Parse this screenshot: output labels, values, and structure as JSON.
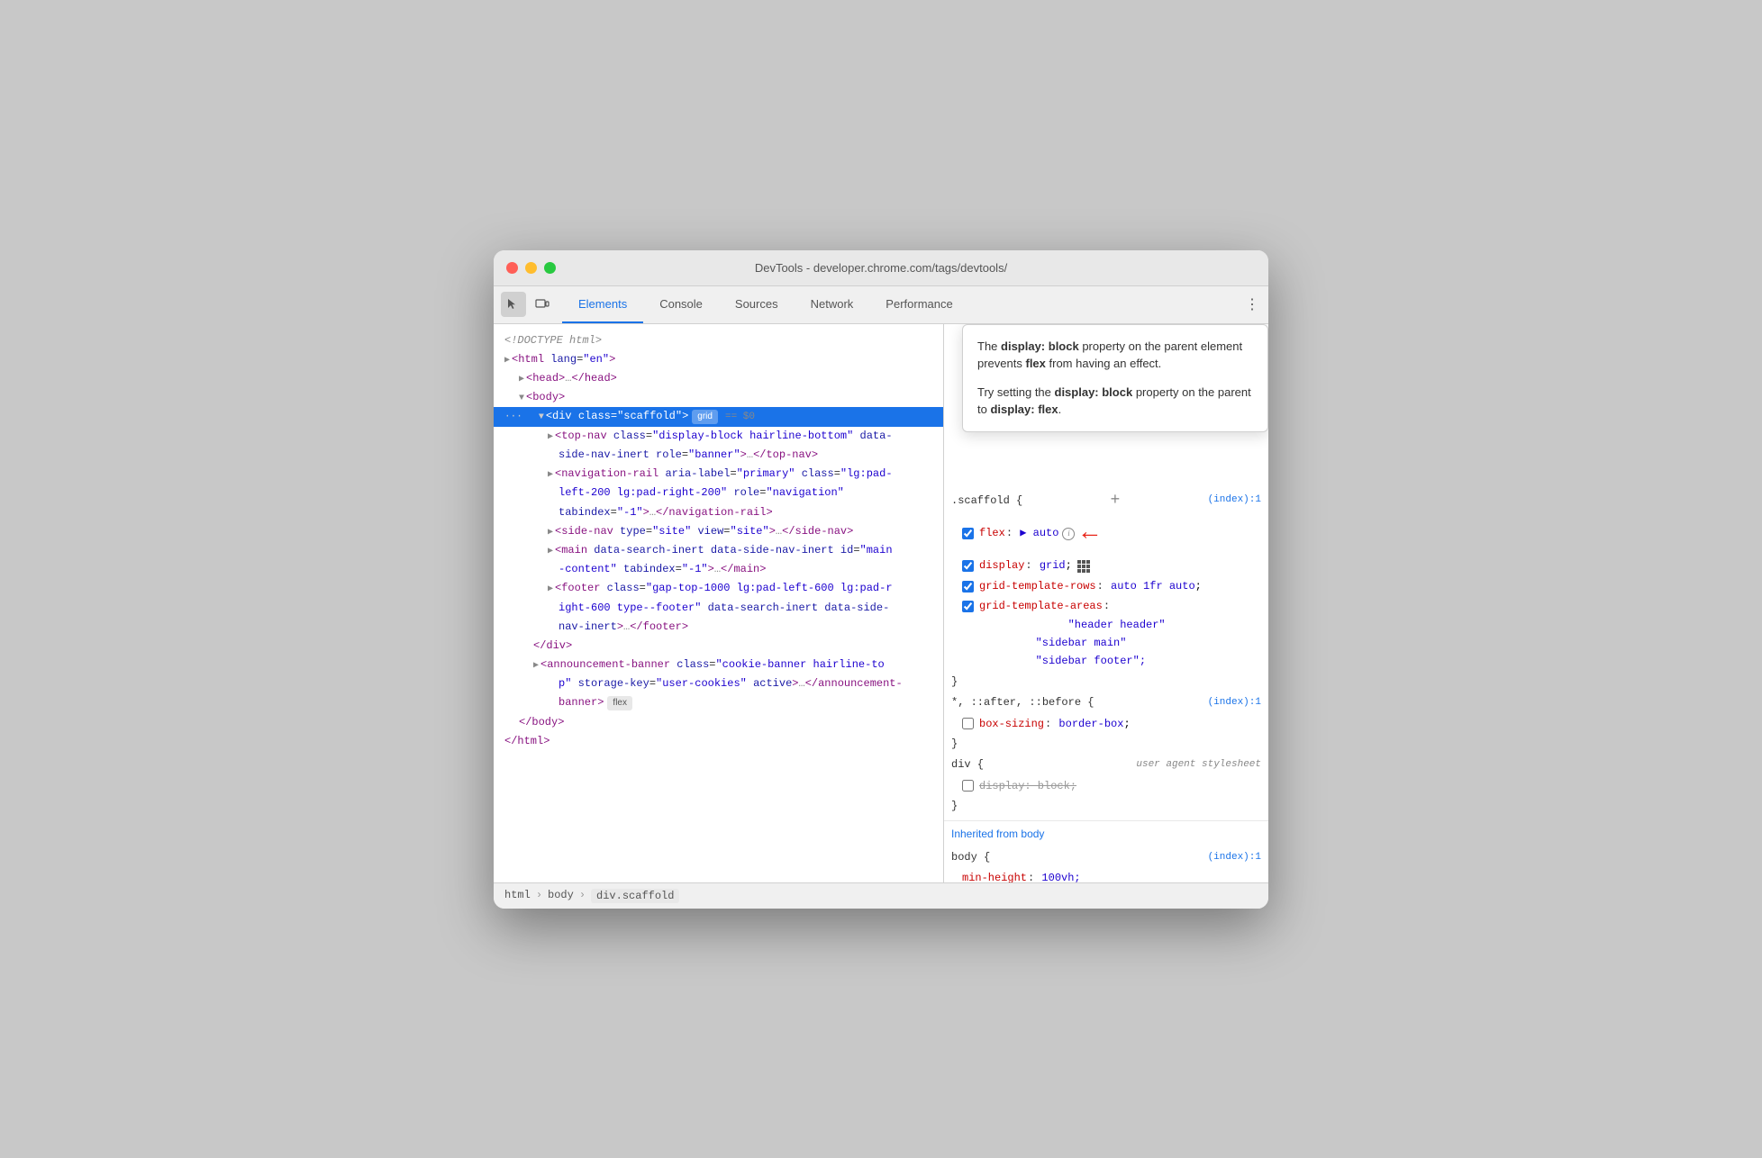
{
  "window": {
    "title": "DevTools - developer.chrome.com/tags/devtools/",
    "buttons": {
      "close": "close",
      "minimize": "minimize",
      "maximize": "maximize"
    }
  },
  "tabbar": {
    "icons": [
      "cursor-icon",
      "device-icon"
    ],
    "tabs": [
      {
        "label": "Elements",
        "active": true
      },
      {
        "label": "Console",
        "active": false
      },
      {
        "label": "Sources",
        "active": false
      },
      {
        "label": "Network",
        "active": false
      },
      {
        "label": "Performance",
        "active": false
      }
    ],
    "more_label": "⋮"
  },
  "tooltip": {
    "line1_text": "The ",
    "line1_bold1": "display: block",
    "line1_text2": " property on the parent element prevents ",
    "line1_bold2": "flex",
    "line1_text3": " from having an effect.",
    "line2_text": "Try setting the ",
    "line2_bold1": "display: block",
    "line2_text2": " property on the parent to ",
    "line2_bold2": "display: flex",
    "line2_text3": "."
  },
  "html_tree": {
    "lines": [
      {
        "indent": 0,
        "text": "<!DOCTYPE html>",
        "type": "comment"
      },
      {
        "indent": 0,
        "text": "<html lang=\"en\">",
        "type": "tag"
      },
      {
        "indent": 1,
        "text": "<head>…</head>",
        "type": "tag",
        "arrow": true
      },
      {
        "indent": 1,
        "text": "<body>",
        "type": "tag",
        "arrow": true,
        "open": true
      },
      {
        "indent": 2,
        "text": "<div class=\"scaffold\">",
        "type": "selected",
        "badge": "grid",
        "eq": "== $0"
      },
      {
        "indent": 3,
        "text": "<top-nav class=\"display-block hairline-bottom\" data-side-nav-inert role=\"banner\">…</top-nav>",
        "type": "tag",
        "arrow": true
      },
      {
        "indent": 3,
        "text": "<navigation-rail aria-label=\"primary\" class=\"lg:pad-left-200 lg:pad-right-200\" role=\"navigation\" tabindex=\"-1\">…</navigation-rail>",
        "type": "tag",
        "arrow": true
      },
      {
        "indent": 3,
        "text": "<side-nav type=\"site\" view=\"site\">…</side-nav>",
        "type": "tag",
        "arrow": true
      },
      {
        "indent": 3,
        "text": "<main data-search-inert data-side-nav-inert id=\"main-content\" tabindex=\"-1\">…</main>",
        "type": "tag",
        "arrow": true
      },
      {
        "indent": 3,
        "text": "<footer class=\"gap-top-1000 lg:pad-left-600 lg:pad-right-600 type--footer\" data-search-inert data-side-nav-inert>…</footer>",
        "type": "tag",
        "arrow": true
      },
      {
        "indent": 2,
        "text": "</div>",
        "type": "tag"
      },
      {
        "indent": 2,
        "text": "<announcement-banner class=\"cookie-banner hairline-top\" storage-key=\"user-cookies\" active>…</announcement-banner>",
        "type": "tag",
        "arrow": true,
        "badge": "flex"
      },
      {
        "indent": 1,
        "text": "</body>",
        "type": "tag"
      },
      {
        "indent": 0,
        "text": "</html>",
        "type": "tag"
      }
    ]
  },
  "css_rules": {
    "sections": [
      {
        "selector": ".scaffold {",
        "origin": "(index):1",
        "properties": [
          {
            "checked": true,
            "name": "flex",
            "value": "auto",
            "has_arrow": true,
            "has_info": true
          },
          {
            "checked": true,
            "name": "display",
            "value": "grid",
            "has_grid_icon": true
          },
          {
            "checked": true,
            "name": "grid-template-rows",
            "value": "auto 1fr auto"
          },
          {
            "checked": true,
            "name": "grid-template-areas",
            "value": "\"header header\"\n\"sidebar main\"\n\"sidebar footer\""
          }
        ]
      },
      {
        "selector": "*, ::after, ::before {",
        "origin": "(index):1",
        "properties": [
          {
            "checked": false,
            "name": "box-sizing",
            "value": "border-box"
          }
        ]
      },
      {
        "selector": "div {",
        "origin": "user agent stylesheet",
        "properties": [
          {
            "checked": false,
            "name": "display",
            "value": "block",
            "strikethrough": true
          }
        ]
      }
    ],
    "inherited_label": "Inherited from",
    "inherited_from": "body",
    "body_section": {
      "selector": "body {",
      "origin": "(index):1",
      "properties": [
        {
          "name": "min-height",
          "value": "100vh"
        }
      ]
    }
  },
  "breadcrumb": {
    "items": [
      "html",
      "body",
      "div.scaffold"
    ]
  }
}
